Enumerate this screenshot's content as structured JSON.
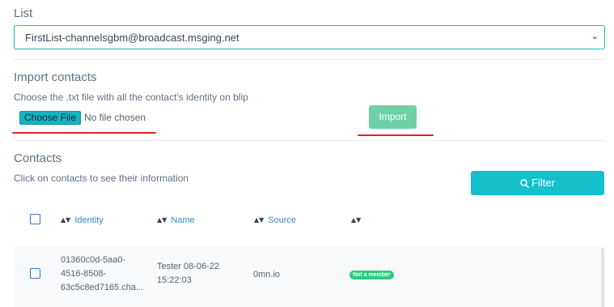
{
  "list": {
    "title": "List",
    "selected": "FirstList-channelsgbm@broadcast.msging.net"
  },
  "import": {
    "title": "Import contacts",
    "hint": "Choose the .txt file with all the contact's identity on blip",
    "choose_file_label": "Choose File",
    "file_status": "No file chosen",
    "import_label": "Import"
  },
  "contacts": {
    "title": "Contacts",
    "hint": "Click on contacts to see their information",
    "filter_label": "Filter",
    "columns": [
      "Identity",
      "Name",
      "Source",
      ""
    ],
    "rows": [
      {
        "identity": [
          "01360c0d-5aa0-",
          "4516-8508-",
          "63c5c8ed7165.cha..."
        ],
        "name": [
          "Tester 08-06-22",
          "15:22:03"
        ],
        "source": "0mn.io",
        "status": "Not a member"
      }
    ]
  },
  "colors": {
    "accent": "#15bfcc",
    "import_button": "#6fd0a8",
    "status_badge": "#2dcc7c",
    "annotation_underline": "#e0202a"
  },
  "icons": [
    "chevron-down-icon",
    "search-icon",
    "sort-icon"
  ]
}
